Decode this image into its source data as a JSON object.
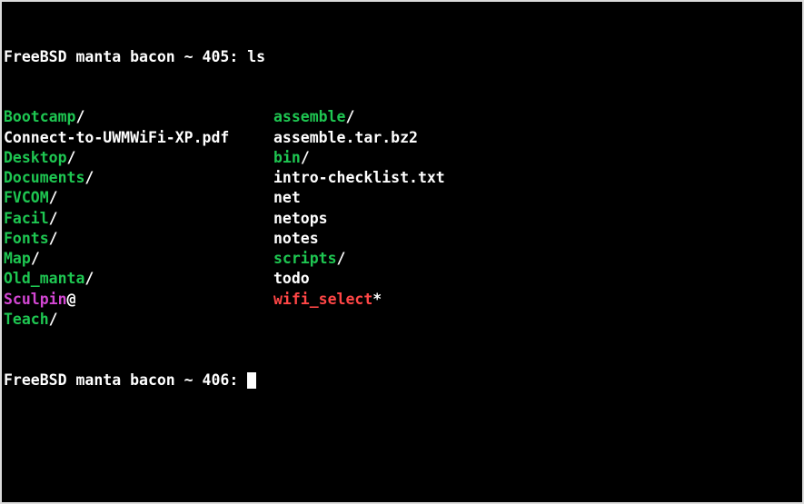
{
  "prompt1": {
    "text": "FreeBSD manta bacon ~ 405: ",
    "command": "ls"
  },
  "listing": [
    {
      "c1_name": "Bootcamp",
      "c1_suffix": "/",
      "c1_class": "dir",
      "c2_name": "assemble",
      "c2_suffix": "/",
      "c2_class": "dir"
    },
    {
      "c1_name": "Connect-to-UWMWiFi-XP.pdf",
      "c1_suffix": "",
      "c1_class": "plain",
      "c2_name": "assemble.tar.bz2",
      "c2_suffix": "",
      "c2_class": "plain"
    },
    {
      "c1_name": "Desktop",
      "c1_suffix": "/",
      "c1_class": "dir",
      "c2_name": "bin",
      "c2_suffix": "/",
      "c2_class": "dir"
    },
    {
      "c1_name": "Documents",
      "c1_suffix": "/",
      "c1_class": "dir",
      "c2_name": "intro-checklist.txt",
      "c2_suffix": "",
      "c2_class": "plain"
    },
    {
      "c1_name": "FVCOM",
      "c1_suffix": "/",
      "c1_class": "dir",
      "c2_name": "net",
      "c2_suffix": "",
      "c2_class": "plain"
    },
    {
      "c1_name": "Facil",
      "c1_suffix": "/",
      "c1_class": "dir",
      "c2_name": "netops",
      "c2_suffix": "",
      "c2_class": "plain"
    },
    {
      "c1_name": "Fonts",
      "c1_suffix": "/",
      "c1_class": "dir",
      "c2_name": "notes",
      "c2_suffix": "",
      "c2_class": "plain"
    },
    {
      "c1_name": "Map",
      "c1_suffix": "/",
      "c1_class": "dir",
      "c2_name": "scripts",
      "c2_suffix": "/",
      "c2_class": "dir"
    },
    {
      "c1_name": "Old_manta",
      "c1_suffix": "/",
      "c1_class": "dir",
      "c2_name": "todo",
      "c2_suffix": "",
      "c2_class": "plain"
    },
    {
      "c1_name": "Sculpin",
      "c1_suffix": "@",
      "c1_class": "link",
      "c2_name": "wifi_select",
      "c2_suffix": "*",
      "c2_class": "exec"
    },
    {
      "c1_name": "Teach",
      "c1_suffix": "/",
      "c1_class": "dir",
      "c2_name": "",
      "c2_suffix": "",
      "c2_class": "plain"
    }
  ],
  "prompt2": {
    "text": "FreeBSD manta bacon ~ 406: "
  }
}
